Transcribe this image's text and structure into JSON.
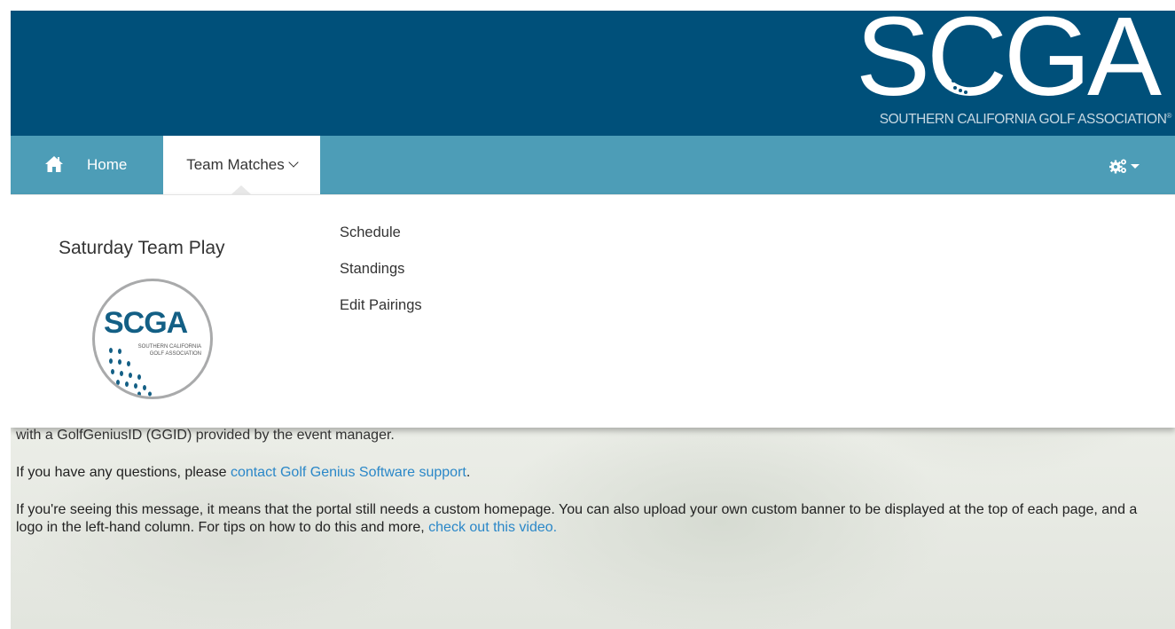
{
  "banner": {
    "logo_letters": "SCGA",
    "logo_tagline": "SOUTHERN CALIFORNIA GOLF ASSOCIATION",
    "logo_trademark": "®"
  },
  "nav": {
    "home_label": "Home",
    "active_label": "Team Matches",
    "icons": {
      "home": "home-icon",
      "settings": "gears-icon",
      "caret": "caret-down-icon"
    }
  },
  "dropdown": {
    "title": "Saturday Team Play",
    "badge": {
      "letters": "SCGA",
      "sub1": "SOUTHERN CALIFORNIA",
      "sub2": "GOLF ASSOCIATION"
    },
    "items": [
      "Schedule",
      "Standings",
      "Edit Pairings"
    ]
  },
  "content": {
    "cut_line": "with a GolfGeniusID (GGID) provided by the event manager.",
    "questions_prefix": "If you have any questions, please ",
    "questions_link": "contact Golf Genius Software support",
    "questions_suffix": ".",
    "message_text": "If you're seeing this message, it means that the portal still needs a custom homepage. You can also upload your own custom banner to be displayed at the top of each page, and a logo in the left-hand column. For tips on how to do this and more, ",
    "message_link": "check out this video."
  },
  "colors": {
    "banner": "#00507a",
    "nav": "#4d9db7",
    "link": "#2a87c8",
    "logo_blue": "#135f85"
  }
}
